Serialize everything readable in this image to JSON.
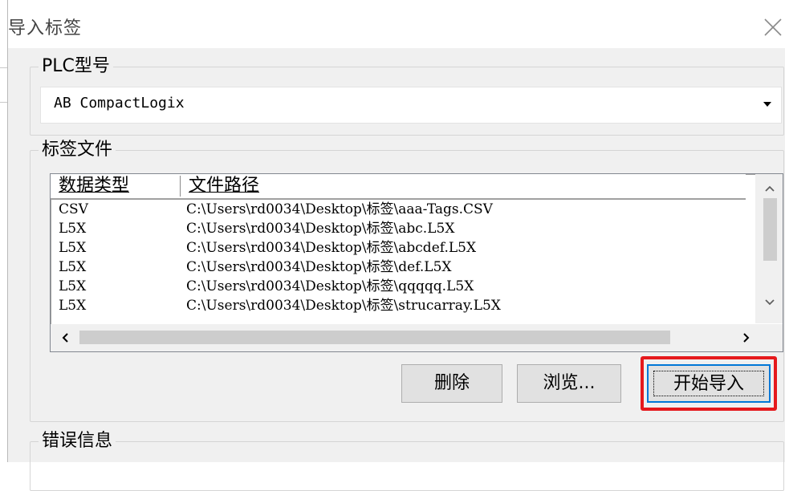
{
  "window": {
    "title": "导入标签"
  },
  "plc_group": {
    "legend": "PLC型号",
    "selected_model": "AB CompactLogix"
  },
  "tag_group": {
    "legend": "标签文件",
    "columns": [
      "数据类型",
      "文件路径"
    ],
    "rows": [
      {
        "type": "CSV",
        "path": "C:\\Users\\rd0034\\Desktop\\标签\\aaa-Tags.CSV"
      },
      {
        "type": "L5X",
        "path": "C:\\Users\\rd0034\\Desktop\\标签\\abc.L5X"
      },
      {
        "type": "L5X",
        "path": "C:\\Users\\rd0034\\Desktop\\标签\\abcdef.L5X"
      },
      {
        "type": "L5X",
        "path": "C:\\Users\\rd0034\\Desktop\\标签\\def.L5X"
      },
      {
        "type": "L5X",
        "path": "C:\\Users\\rd0034\\Desktop\\标签\\qqqqq.L5X"
      },
      {
        "type": "L5X",
        "path": "C:\\Users\\rd0034\\Desktop\\标签\\strucarray.L5X"
      }
    ]
  },
  "buttons": {
    "delete": "删除",
    "browse": "浏览...",
    "start_import": "开始导入"
  },
  "error_group": {
    "legend": "错误信息"
  },
  "colors": {
    "highlight": "#e5191c",
    "focus_border": "#0078d7"
  }
}
